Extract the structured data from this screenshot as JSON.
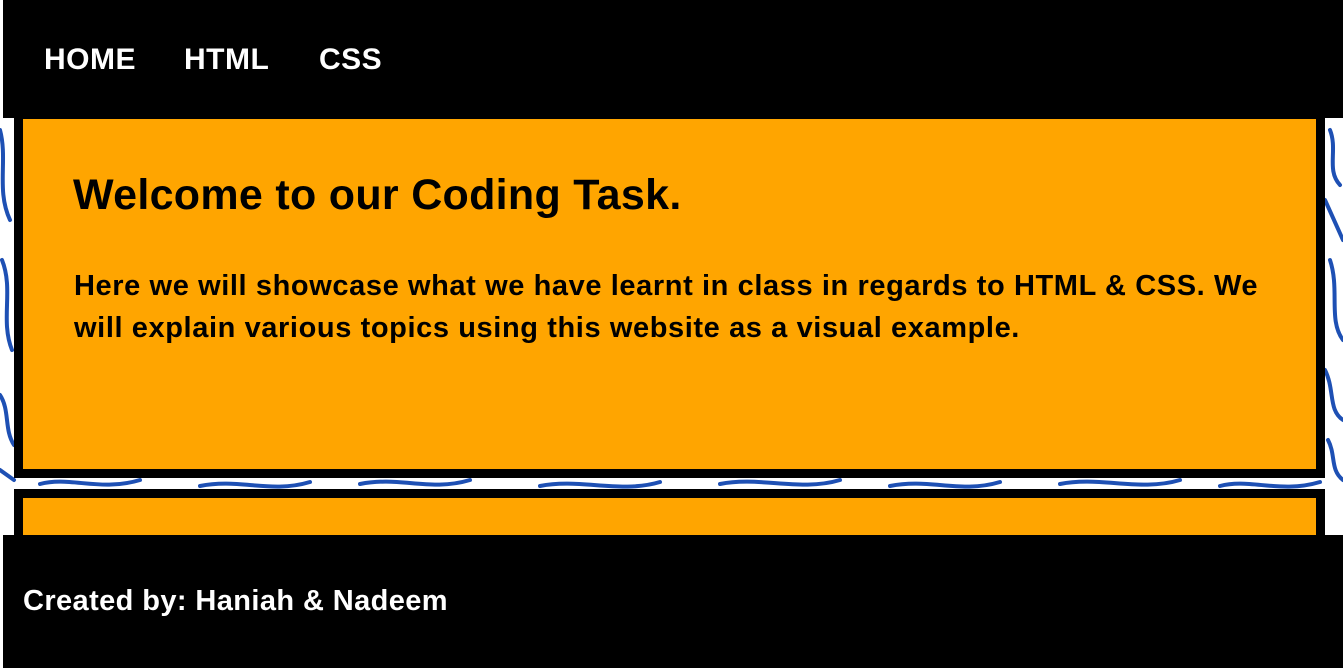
{
  "nav": {
    "items": [
      {
        "label": "HOME"
      },
      {
        "label": "HTML"
      },
      {
        "label": "CSS"
      }
    ]
  },
  "main": {
    "heading": "Welcome to our Coding Task.",
    "intro": "Here we will showcase what we have learnt in class in regards to HTML & CSS. We will explain various topics using this website as a visual example."
  },
  "footer": {
    "credit": "Created by: Haniah & Nadeem"
  },
  "colors": {
    "nav_background": "#000000",
    "card_background": "#FFA500",
    "card_border": "#000000",
    "doodle_stroke": "#1E50B4",
    "page_background": "#FFFFFF"
  }
}
